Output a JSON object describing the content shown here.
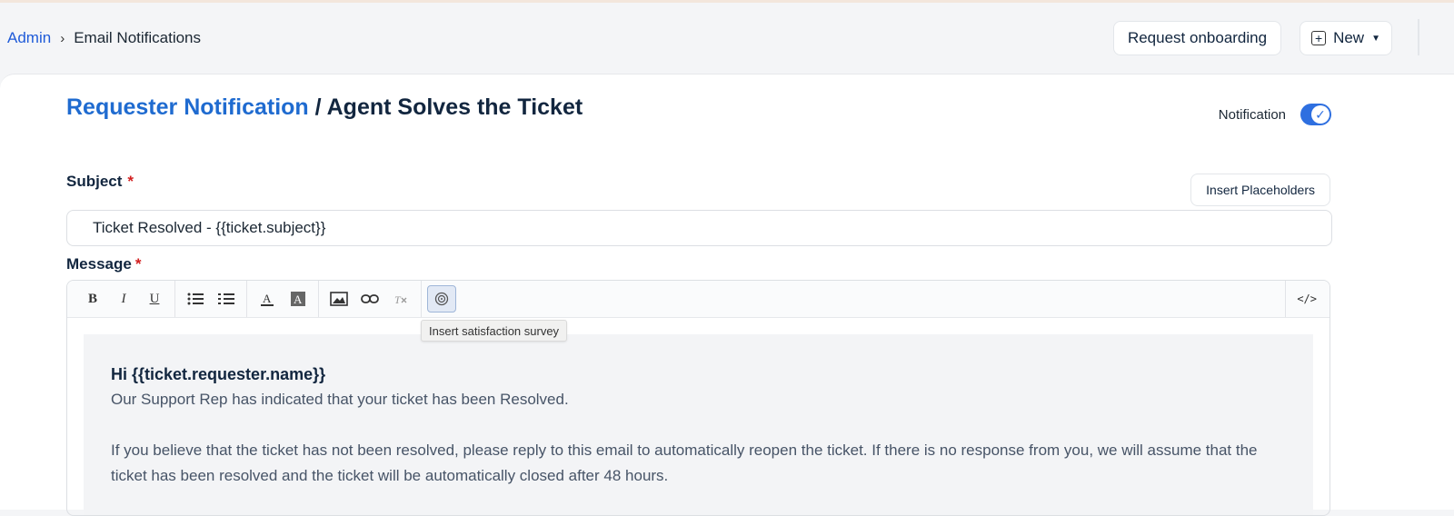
{
  "breadcrumb": {
    "root": "Admin",
    "separator": "›",
    "current": "Email Notifications"
  },
  "header": {
    "request_onboarding_label": "Request onboarding",
    "new_label": "New"
  },
  "page": {
    "title_link": "Requester Notification",
    "title_separator": " / ",
    "title_rest": "Agent Solves the Ticket",
    "notification_label": "Notification",
    "notification_enabled": true
  },
  "subject": {
    "label": "Subject",
    "required_mark": "*",
    "value": "Ticket Resolved - {{ticket.subject}}",
    "insert_placeholders_label": "Insert Placeholders"
  },
  "message": {
    "label": "Message",
    "required_mark": "*",
    "toolbar": {
      "bold": "B",
      "italic": "I",
      "underline": "U",
      "code_view": "</>",
      "tooltip": "Insert satisfaction survey"
    },
    "body": {
      "greeting": "Hi {{ticket.requester.name}}",
      "line1": "Our Support Rep has indicated that your ticket has been Resolved.",
      "line2": "If you believe that the ticket has not been resolved, please reply to this email to automatically reopen the ticket. If there is no response from you, we will assume that the ticket has been resolved and the ticket will be automatically closed after 48 hours."
    }
  },
  "colors": {
    "accent": "#1f6bd0",
    "link": "#1f5bd8",
    "required": "#d21f1f",
    "toggle": "#2e6fe0"
  }
}
